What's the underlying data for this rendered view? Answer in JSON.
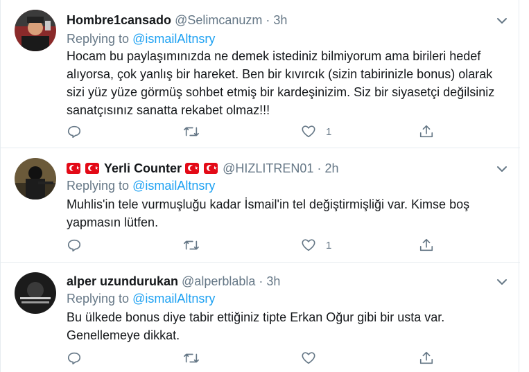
{
  "replying_prefix": "Replying to",
  "tweets": [
    {
      "name": "Hombre1cansado",
      "handle": "@Selimcanuzm",
      "separator": "·",
      "time": "3h",
      "reply_to": "@ismailAltnsry",
      "text": "Hocam bu paylaşımınızda ne demek istediniz bilmiyorum ama birileri hedef alıyorsa, çok yanlış bir hareket. Ben bir kıvırcık (sizin tabirinizle bonus) olarak sizi yüz yüze görmüş sohbet etmiş bir kardeşinizim. Siz bir siyasetçi değilsiniz sanatçısınız sanatta rekabet olmaz!!!",
      "like_count": "1"
    },
    {
      "name": "Yerli Counter",
      "handle": "@HIZLITREN01",
      "separator": "·",
      "time": "2h",
      "reply_to": "@ismailAltnsry",
      "text": "Muhlis'in tele vurmuşluğu kadar İsmail'in tel değiştirmişliği var. Kimse boş yapmasın lütfen.",
      "like_count": "1"
    },
    {
      "name": "alper uzundurukan",
      "handle": "@alperblabla",
      "separator": "·",
      "time": "3h",
      "reply_to": "@ismailAltnsry",
      "text": "Bu ülkede bonus diye tabir ettiğiniz tipte Erkan Oğur gibi bir usta var. Genellemeye dikkat.",
      "like_count": ""
    }
  ],
  "icons": {
    "reply": "reply-icon",
    "retweet": "retweet-icon",
    "like": "heart-icon",
    "share": "share-icon",
    "more": "chevron-down-icon"
  },
  "colors": {
    "link": "#1da1f2",
    "muted": "#657786",
    "text": "#14171a",
    "divider": "#e6ecf0",
    "flag": "#e30a17"
  }
}
